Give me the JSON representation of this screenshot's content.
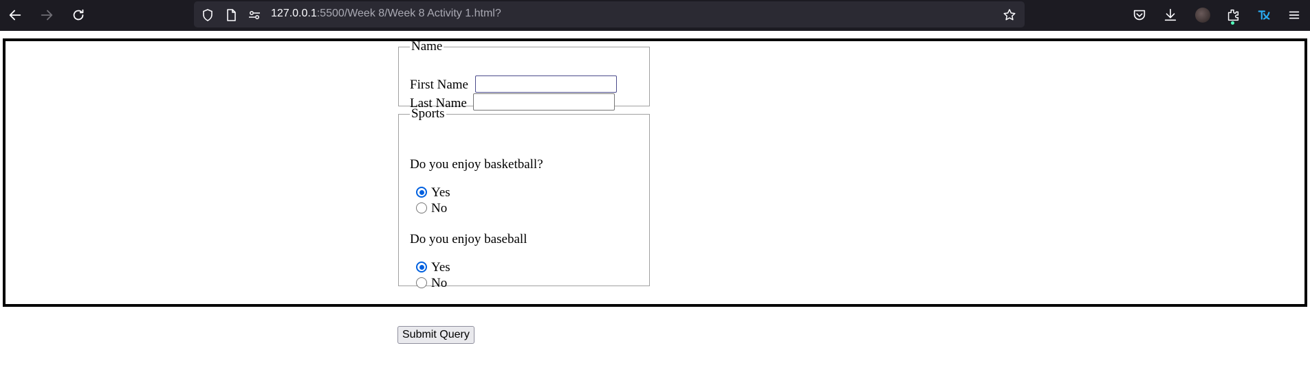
{
  "browser": {
    "url_host": "127.0.0.1",
    "url_path": ":5500/Week 8/Week 8 Activity 1.html?"
  },
  "form": {
    "name_legend": "Name",
    "first_name_label": "First Name",
    "first_name_value": "",
    "last_name_label": "Last Name",
    "last_name_value": "",
    "sports_legend": "Sports",
    "q1": "Do you enjoy basketball?",
    "q1_yes": "Yes",
    "q1_no": "No",
    "q1_selected": "Yes",
    "q2": "Do you enjoy baseball",
    "q2_yes": "Yes",
    "q2_no": "No",
    "q2_selected": "Yes",
    "submit_label": "Submit Query"
  }
}
